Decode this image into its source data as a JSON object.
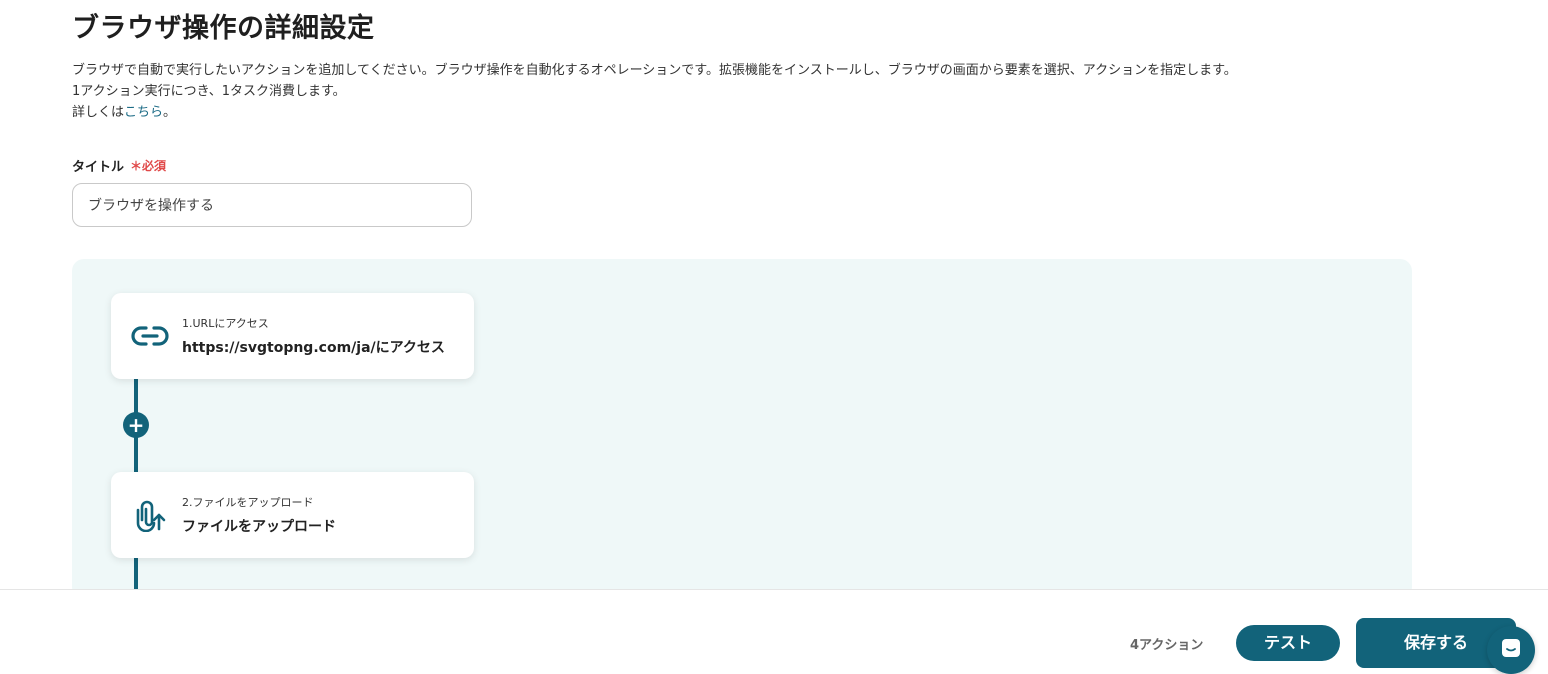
{
  "page": {
    "title": "ブラウザ操作の詳細設定",
    "description": {
      "line1": "ブラウザで自動で実行したいアクションを追加してください。ブラウザ操作を自動化するオペレーションです。拡張機能をインストールし、ブラウザの画面から要素を選択、アクションを指定します。",
      "line2": "1アクション実行につき、1タスク消費します。",
      "line3_prefix": "詳しくは",
      "line3_link": "こちら",
      "line3_suffix": "。"
    }
  },
  "form": {
    "title_label": "タイトル",
    "required_label": "＊必須",
    "title_value": "ブラウザを操作する"
  },
  "flow": {
    "add_step_symbol": "+",
    "steps": [
      {
        "subtitle": "1.URLにアクセス",
        "title": "https://svgtopng.com/ja/にアクセス",
        "icon": "link-icon"
      },
      {
        "subtitle": "2.ファイルをアップロード",
        "title": "ファイルをアップロード",
        "icon": "paperclip-upload-icon"
      }
    ]
  },
  "footer": {
    "action_count": "4アクション",
    "test_label": "テスト",
    "save_label": "保存する"
  },
  "colors": {
    "primary": "#12637a",
    "required": "#e04949",
    "flow_background": "#eff8f8"
  }
}
